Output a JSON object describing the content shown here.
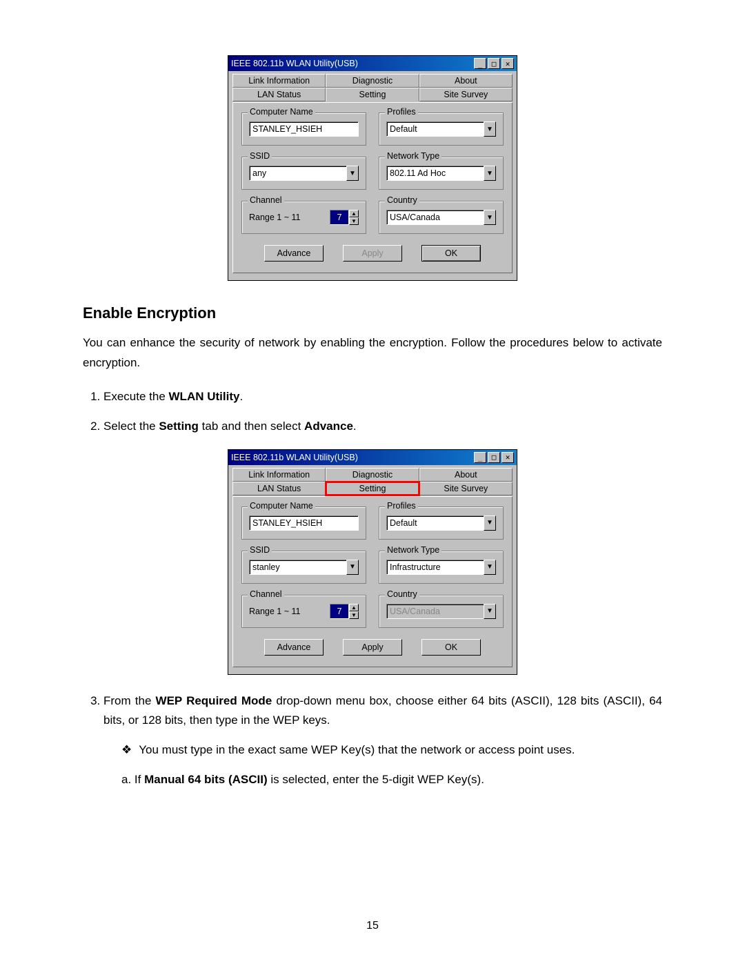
{
  "dialog1": {
    "title": "IEEE 802.11b WLAN Utility(USB)",
    "tabs_back": [
      "Link Information",
      "Diagnostic",
      "About"
    ],
    "tabs_front": [
      "LAN Status",
      "Setting",
      "Site Survey"
    ],
    "active_tab": "Setting",
    "computer_name_legend": "Computer Name",
    "computer_name_value": "STANLEY_HSIEH",
    "profiles_legend": "Profiles",
    "profiles_value": "Default",
    "ssid_legend": "SSID",
    "ssid_value": "any",
    "network_type_legend": "Network Type",
    "network_type_value": "802.11 Ad Hoc",
    "channel_legend": "Channel",
    "channel_range_label": "Range 1 ~ 11",
    "channel_value": "7",
    "country_legend": "Country",
    "country_value": "USA/Canada",
    "country_disabled": false,
    "buttons": {
      "advance": "Advance",
      "apply": "Apply",
      "ok": "OK",
      "apply_disabled": true,
      "ok_default": true
    }
  },
  "dialog2": {
    "title": "IEEE 802.11b WLAN Utility(USB)",
    "tabs_back": [
      "Link Information",
      "Diagnostic",
      "About"
    ],
    "tabs_front": [
      "LAN Status",
      "Setting",
      "Site Survey"
    ],
    "active_tab": "Setting",
    "highlight_tab": "Setting",
    "computer_name_legend": "Computer Name",
    "computer_name_value": "STANLEY_HSIEH",
    "profiles_legend": "Profiles",
    "profiles_value": "Default",
    "ssid_legend": "SSID",
    "ssid_value": "stanley",
    "network_type_legend": "Network Type",
    "network_type_value": "Infrastructure",
    "channel_legend": "Channel",
    "channel_range_label": "Range 1 ~ 11",
    "channel_value": "7",
    "country_legend": "Country",
    "country_value": "USA/Canada",
    "country_disabled": true,
    "buttons": {
      "advance": "Advance",
      "apply": "Apply",
      "ok": "OK",
      "apply_disabled": false,
      "ok_default": false
    }
  },
  "doc": {
    "section_heading": "Enable Encryption",
    "intro": "You can enhance the security of network by enabling the encryption.  Follow the procedures below to activate encryption.",
    "step1_pre": "Execute the ",
    "step1_bold": "WLAN Utility",
    "step1_post": ".",
    "step2_pre": "Select the ",
    "step2_bold1": "Setting",
    "step2_mid": " tab and then select ",
    "step2_bold2": "Advance",
    "step2_post": ".",
    "step3_pre": "From the ",
    "step3_bold": "WEP Required Mode",
    "step3_post": " drop-down menu box, choose either 64 bits (ASCII), 128 bits (ASCII), 64 bits, or 128 bits, then type in the WEP keys.",
    "bullet_symbol": "❖",
    "bullet_text": "You must type in the exact same WEP Key(s) that the network or access point uses.",
    "sub_a_pre": "a.   If ",
    "sub_a_bold": "Manual 64 bits (ASCII)",
    "sub_a_post": " is selected, enter the 5-digit WEP Key(s).",
    "page_number": "15"
  },
  "glyphs": {
    "min": "_",
    "max": "□",
    "close": "✕",
    "down": "▼",
    "up": "▲"
  }
}
